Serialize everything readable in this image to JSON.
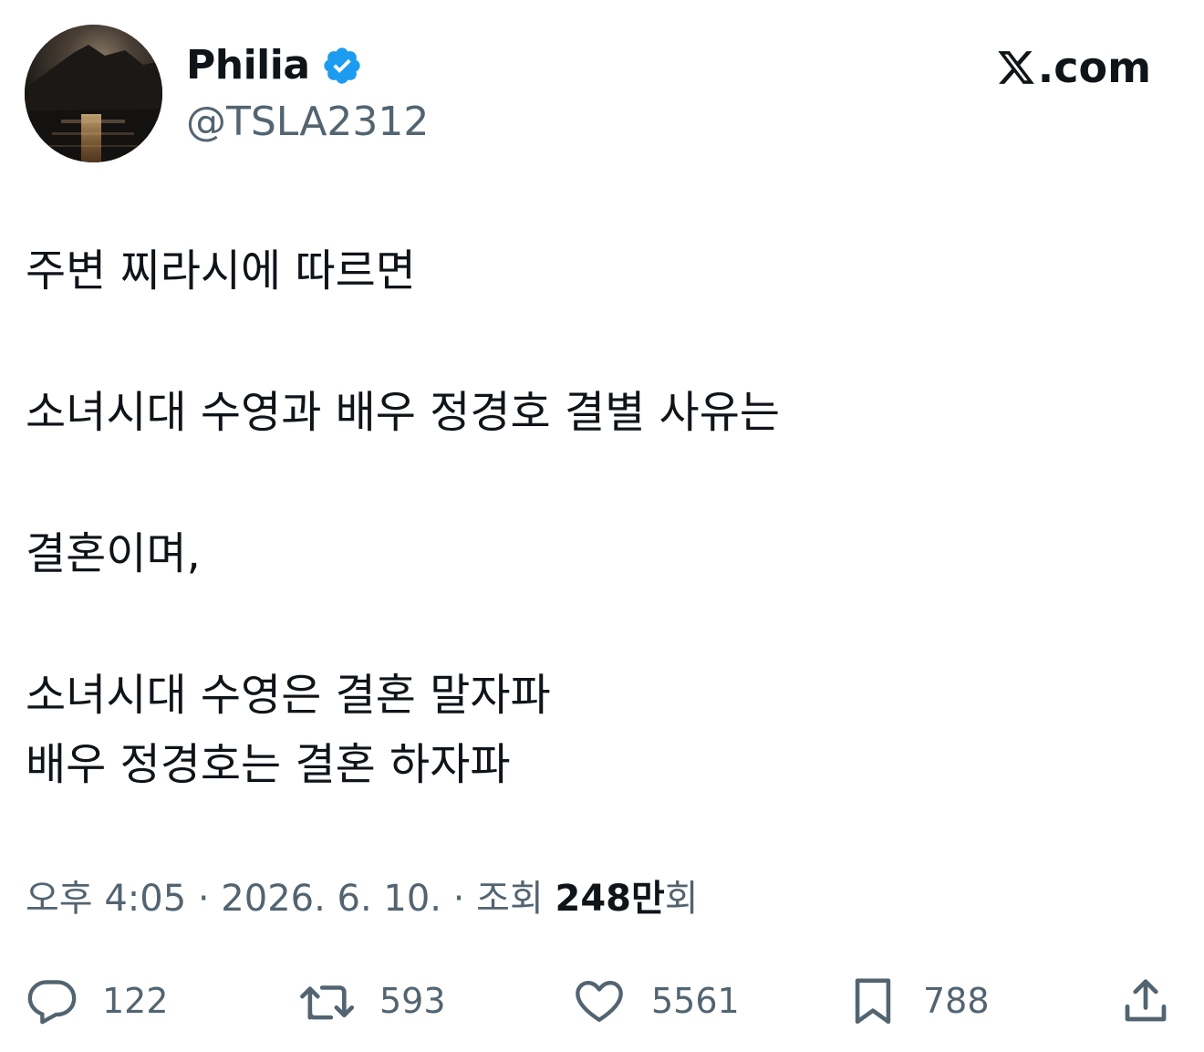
{
  "author": {
    "display_name": "Philia",
    "handle": "@TSLA2312",
    "verified": true,
    "verified_icon": "verified-badge-icon",
    "verified_color": "#1d9bf0"
  },
  "brand": {
    "icon": "x-logo-icon",
    "text": ".com"
  },
  "tweet": {
    "lines": [
      "주변 찌라시에 따르면",
      "소녀시대 수영과 배우 정경호 결별 사유는",
      "결혼이며,",
      "소녀시대 수영은 결혼 말자파",
      "배우 정경호는 결혼 하자파"
    ]
  },
  "meta": {
    "time": "오후 4:05",
    "separator": " · ",
    "date": "2026. 6. 10.",
    "views_prefix": "조회 ",
    "views_count": "248만",
    "views_suffix": "회"
  },
  "actions": {
    "reply": {
      "icon": "reply-icon",
      "count": "122"
    },
    "retweet": {
      "icon": "retweet-icon",
      "count": "593"
    },
    "like": {
      "icon": "heart-icon",
      "count": "5561"
    },
    "bookmark": {
      "icon": "bookmark-icon",
      "count": "788"
    },
    "share": {
      "icon": "share-icon"
    }
  },
  "colors": {
    "text_primary": "#0f1419",
    "text_secondary": "#536471",
    "accent": "#1d9bf0"
  }
}
